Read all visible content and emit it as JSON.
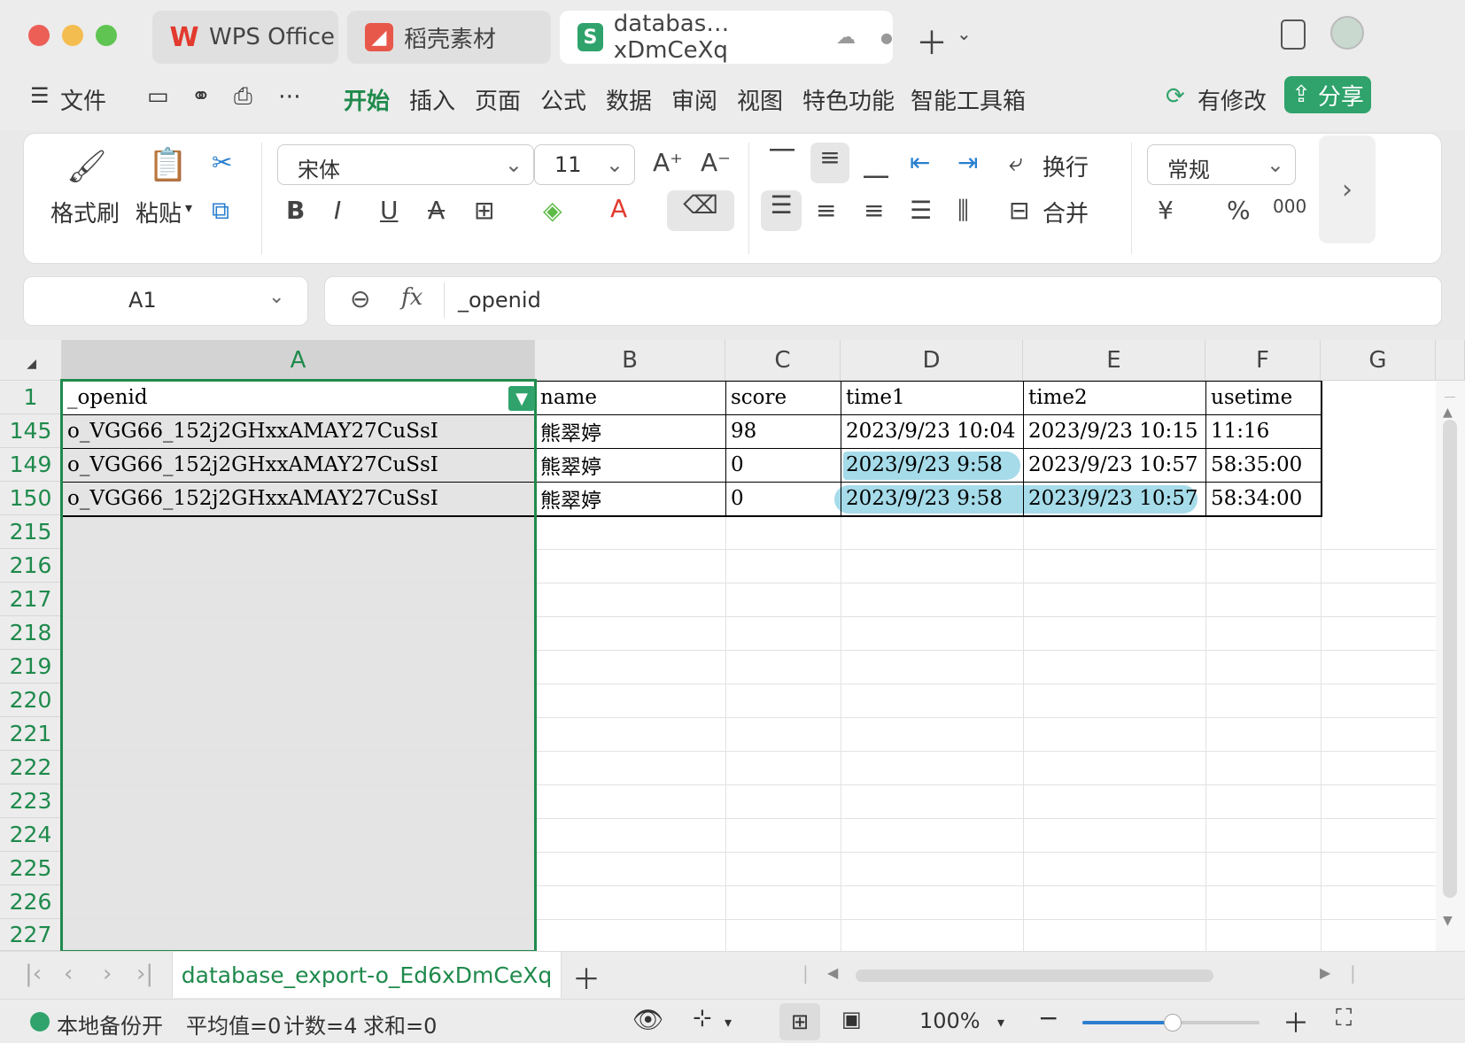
{
  "window": {
    "tabs": [
      {
        "label": "WPS Office",
        "active": false
      },
      {
        "label": "稻壳素材",
        "active": false
      },
      {
        "label": "databas…xDmCeXq",
        "active": true
      }
    ]
  },
  "menu": {
    "file": "文件",
    "items": [
      "开始",
      "插入",
      "页面",
      "公式",
      "数据",
      "审阅",
      "视图",
      "特色功能",
      "智能工具箱"
    ],
    "active": "开始",
    "modified": "有修改",
    "share": "分享"
  },
  "ribbon": {
    "format_painter": "格式刷",
    "paste": "粘贴",
    "font_name": "宋体",
    "font_size": "11",
    "wrap": "换行",
    "merge": "合并",
    "number_format": "常规"
  },
  "formula": {
    "cell_ref": "A1",
    "fx": "fx",
    "content": "_openid"
  },
  "sheet": {
    "columns": [
      "A",
      "B",
      "C",
      "D",
      "E",
      "F",
      "G"
    ],
    "row_numbers": [
      "1",
      "145",
      "149",
      "150",
      "215",
      "216",
      "217",
      "218",
      "219",
      "220",
      "221",
      "222",
      "223",
      "224",
      "225",
      "226",
      "227"
    ],
    "header_row": [
      "_openid",
      "name",
      "score",
      "time1",
      "time2",
      "usetime"
    ],
    "rows": [
      [
        "o_VGG66_152j2GHxxAMAY27CuSsI",
        "熊翠婷",
        "98",
        "2023/9/23 10:04",
        "2023/9/23 10:15",
        "11:16"
      ],
      [
        "o_VGG66_152j2GHxxAMAY27CuSsI",
        "熊翠婷",
        "0",
        "2023/9/23 9:58",
        "2023/9/23 10:57",
        "58:35:00"
      ],
      [
        "o_VGG66_152j2GHxxAMAY27CuSsI",
        "熊翠婷",
        "0",
        "2023/9/23 9:58",
        "2023/9/23 10:57",
        "58:34:00"
      ]
    ],
    "tab_name": "database_export-o_Ed6xDmCeXq"
  },
  "status": {
    "backup": "本地备份开",
    "average": "平均值=0",
    "count": "计数=4",
    "sum": "求和=0",
    "zoom": "100%"
  },
  "colors": {
    "accent": "#1f8a4c",
    "share_bg": "#2fa36b",
    "highlight": "#a6dbe9"
  }
}
